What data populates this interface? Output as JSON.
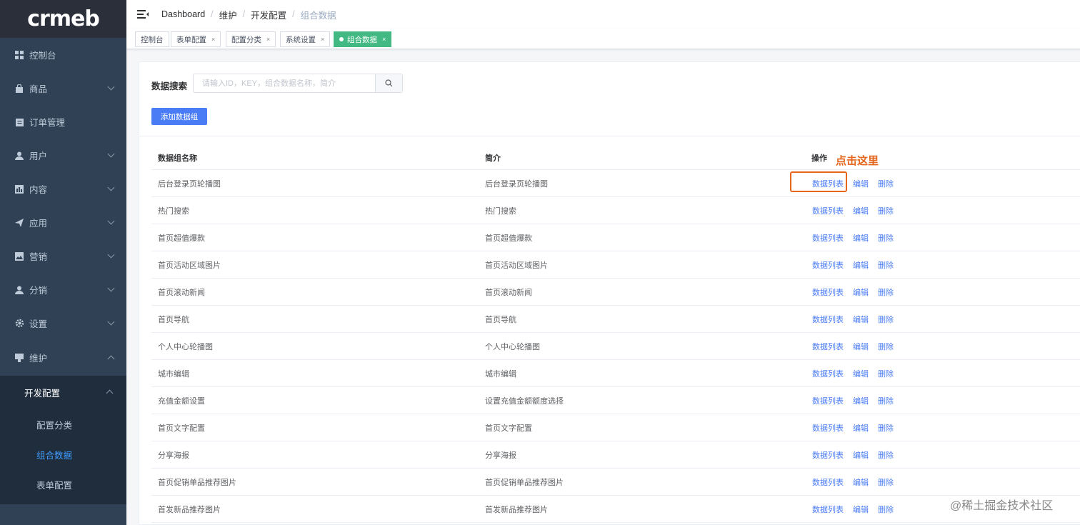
{
  "logo": "crmeb",
  "sidebar": {
    "items": [
      {
        "label": "控制台",
        "icon": "dashboard-icon"
      },
      {
        "label": "商品",
        "icon": "shopping-bag-icon"
      },
      {
        "label": "订单管理",
        "icon": "clipboard-icon"
      },
      {
        "label": "用户",
        "icon": "user-icon"
      },
      {
        "label": "内容",
        "icon": "chart-icon"
      },
      {
        "label": "应用",
        "icon": "send-icon"
      },
      {
        "label": "营销",
        "icon": "image-icon"
      },
      {
        "label": "分销",
        "icon": "user-icon"
      },
      {
        "label": "设置",
        "icon": "gear-icon"
      },
      {
        "label": "维护",
        "icon": "tag-icon"
      }
    ],
    "submenu": {
      "title": "开发配置",
      "items": [
        "配置分类",
        "组合数据",
        "表单配置"
      ],
      "active_index": 1
    }
  },
  "breadcrumb": [
    "Dashboard",
    "维护",
    "开发配置",
    "组合数据"
  ],
  "tags": [
    {
      "label": "控制台",
      "closable": false
    },
    {
      "label": "表单配置",
      "closable": true
    },
    {
      "label": "配置分类",
      "closable": true
    },
    {
      "label": "系统设置",
      "closable": true
    },
    {
      "label": "组合数据",
      "closable": true,
      "active": true
    }
  ],
  "search": {
    "label": "数据搜索",
    "placeholder": "请输入ID，KEY，组合数据名称，简介"
  },
  "add_button": "添加数据组",
  "table": {
    "headers": [
      "数据组名称",
      "简介",
      "操作"
    ],
    "ops": [
      "数据列表",
      "编辑",
      "删除"
    ],
    "rows": [
      [
        "后台登录页轮播图",
        "后台登录页轮播图"
      ],
      [
        "热门搜索",
        "热门搜索"
      ],
      [
        "首页超值爆款",
        "首页超值爆款"
      ],
      [
        "首页活动区域图片",
        "首页活动区域图片"
      ],
      [
        "首页滚动新闻",
        "首页滚动新闻"
      ],
      [
        "首页导航",
        "首页导航"
      ],
      [
        "个人中心轮播图",
        "个人中心轮播图"
      ],
      [
        "城市编辑",
        "城市编辑"
      ],
      [
        "充值金额设置",
        "设置充值金额额度选择"
      ],
      [
        "首页文字配置",
        "首页文字配置"
      ],
      [
        "分享海报",
        "分享海报"
      ],
      [
        "首页促销单品推荐图片",
        "首页促销单品推荐图片"
      ],
      [
        "首发新品推荐图片",
        "首发新品推荐图片"
      ]
    ]
  },
  "annotation": "点击这里",
  "watermark": "@稀土掘金技术社区",
  "colors": {
    "sidebar_bg": "#304156",
    "accent": "#4a7cf6",
    "active_tag": "#42b983",
    "annotation": "#e4651b"
  }
}
